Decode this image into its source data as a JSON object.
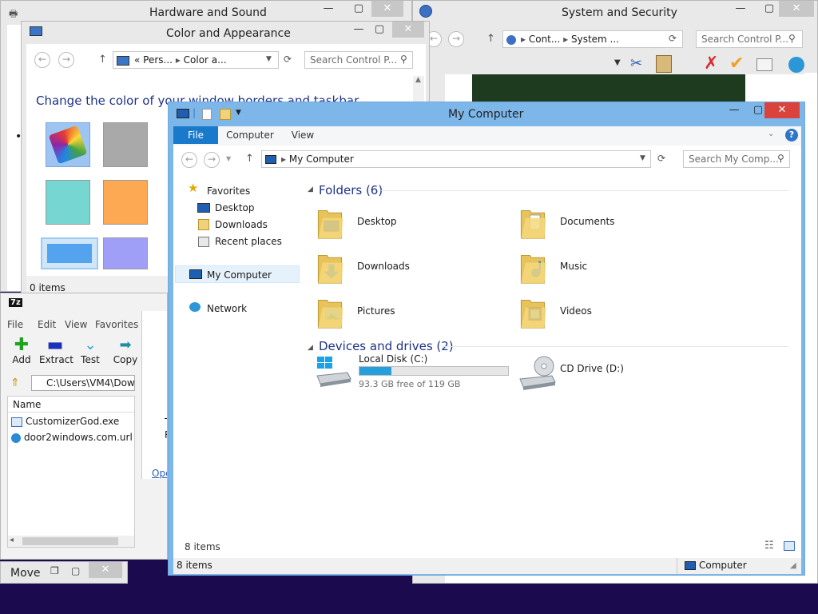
{
  "hardware": {
    "title": "Hardware and Sound",
    "min": "—",
    "max": "▢",
    "close": "✕"
  },
  "system": {
    "title": "System and Security",
    "min": "—",
    "max": "▢",
    "close": "✕",
    "addr_part1": "Cont...",
    "addr_part2": "System ...",
    "search_placeholder": "Search Control P..."
  },
  "color_window": {
    "title": "Color and Appearance",
    "min": "—",
    "max": "▢",
    "close": "✕",
    "addr_prefix": "«",
    "addr_part1": "Pers...",
    "addr_part2": "Color a...",
    "search_placeholder": "Search Control P...",
    "heading": "Change the color of your window borders and taskbar",
    "status": "0 items"
  },
  "color_tiles": [
    "#9ec5f2",
    "#a9a9a9",
    "#76d7d2",
    "#fda853",
    "#53a3ee",
    "#9f9ff7"
  ],
  "sevenzip": {
    "logo": "7z",
    "menu": [
      "File",
      "Edit",
      "View",
      "Favorites"
    ],
    "toolbar": [
      {
        "label": "Add",
        "icon": "add-icon"
      },
      {
        "label": "Extract",
        "icon": "extract-icon"
      },
      {
        "label": "Test",
        "icon": "test-icon"
      },
      {
        "label": "Copy",
        "icon": "copy-icon"
      }
    ],
    "path": "C:\\Users\\VM4\\Dow",
    "column_name": "Name",
    "files": [
      {
        "name": "CustomizerGod.exe",
        "icon": "exe-icon"
      },
      {
        "name": "door2windows.com.url",
        "icon": "globe-icon"
      }
    ],
    "partial_text": [
      "T",
      "R"
    ],
    "partial_link": "Ope"
  },
  "move_bar": {
    "label": "Move",
    "restore": "❐",
    "max": "▢",
    "close": "✕"
  },
  "explorer": {
    "title": "My Computer",
    "min": "—",
    "max": "▢",
    "close": "✕",
    "tabs": [
      "File",
      "Computer",
      "View"
    ],
    "help": "?",
    "address": "My Computer",
    "search_placeholder": "Search My Comp...",
    "nav": {
      "favorites": "Favorites",
      "desktop": "Desktop",
      "downloads": "Downloads",
      "recent": "Recent places",
      "computer": "My Computer",
      "network": "Network"
    },
    "folders_header": "Folders (6)",
    "folders": [
      {
        "name": "Desktop",
        "icon": "desktop-folder-icon"
      },
      {
        "name": "Documents",
        "icon": "documents-folder-icon"
      },
      {
        "name": "Downloads",
        "icon": "downloads-folder-icon"
      },
      {
        "name": "Music",
        "icon": "music-folder-icon"
      },
      {
        "name": "Pictures",
        "icon": "pictures-folder-icon"
      },
      {
        "name": "Videos",
        "icon": "videos-folder-icon"
      }
    ],
    "drives_header": "Devices and drives (2)",
    "drives": [
      {
        "name": "Local Disk (C:)",
        "free": "93.3 GB free of 119 GB",
        "used_fraction": 0.216
      },
      {
        "name": "CD Drive (D:)"
      }
    ],
    "status_inner": "8 items",
    "status_outer": "8 items",
    "status_right": "Computer"
  },
  "colors": {
    "accent_blue": "#3c8ce0",
    "selection": "#cde8ff",
    "explorer_frame": "#7db7ea",
    "close_red": "#d9433b",
    "file_tab": "#1979ca"
  }
}
